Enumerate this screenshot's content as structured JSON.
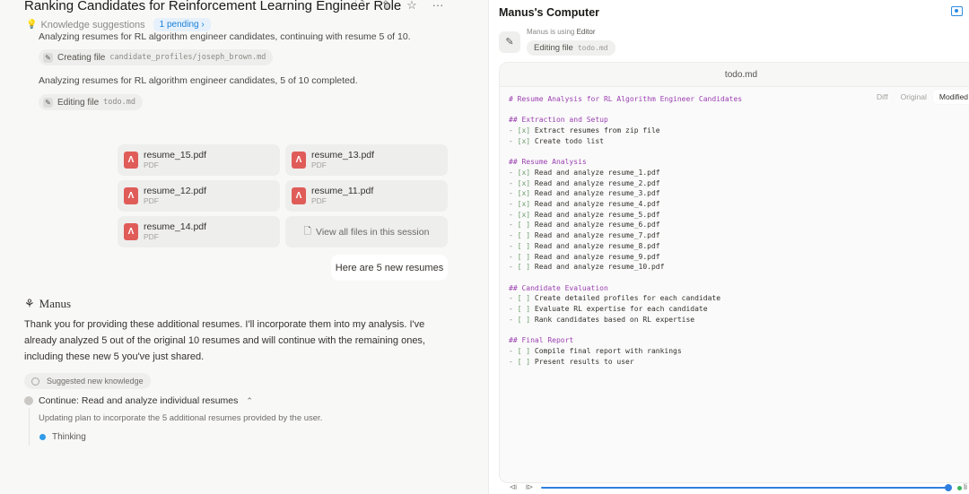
{
  "chat": {
    "title": "Ranking Candidates for Reinforcement Learning Engineer Role",
    "title_actions": [
      "file-icon",
      "share-icon",
      "star-icon",
      "more-icon"
    ],
    "knowledge": {
      "label": "Knowledge suggestions",
      "pending": "1 pending"
    },
    "steps": [
      {
        "text": "Analyzing resumes for RL algorithm engineer candidates, continuing with resume 5 of 10.",
        "action": "Creating file",
        "target": "candidate_profiles/joseph_brown.md"
      },
      {
        "text": "Analyzing resumes for RL algorithm engineer candidates, 5 of 10 completed.",
        "action": "Editing file",
        "target": "todo.md"
      }
    ],
    "files": [
      {
        "name": "resume_15.pdf",
        "type": "PDF"
      },
      {
        "name": "resume_13.pdf",
        "type": "PDF"
      },
      {
        "name": "resume_12.pdf",
        "type": "PDF"
      },
      {
        "name": "resume_11.pdf",
        "type": "PDF"
      },
      {
        "name": "resume_14.pdf",
        "type": "PDF"
      }
    ],
    "view_all": "View all files in this session",
    "user_message": "Here are 5 new resumes",
    "assistant_name": "Manus",
    "assistant_message": "Thank you for providing these additional resumes. I'll incorporate them into my analysis. I've already analyzed 5 out of the original 10 resumes and will continue with the remaining ones, including these new 5 you've just shared.",
    "suggested_knowledge": "Suggested new knowledge",
    "task": {
      "title": "Continue: Read and analyze individual resumes",
      "description": "Updating plan to incorporate the 5 additional resumes provided by the user.",
      "status": "Thinking"
    }
  },
  "computer": {
    "title": "Manus's Computer",
    "using_prefix": "Manus is using",
    "tool": "Editor",
    "action": "Editing file",
    "file": "todo.md",
    "editor_title": "todo.md",
    "view_tabs": [
      "Diff",
      "Original",
      "Modified"
    ],
    "active_view": "Modified",
    "code_lines": [
      {
        "kind": "h",
        "text": "# Resume Analysis for RL Algorithm Engineer Candidates"
      },
      {
        "kind": "blank",
        "text": ""
      },
      {
        "kind": "h",
        "text": "## Extraction and Setup"
      },
      {
        "kind": "item",
        "checked": true,
        "text": "Extract resumes from zip file"
      },
      {
        "kind": "item",
        "checked": true,
        "text": "Create todo list"
      },
      {
        "kind": "blank",
        "text": ""
      },
      {
        "kind": "h",
        "text": "## Resume Analysis"
      },
      {
        "kind": "item",
        "checked": true,
        "text": "Read and analyze resume_1.pdf"
      },
      {
        "kind": "item",
        "checked": true,
        "text": "Read and analyze resume_2.pdf"
      },
      {
        "kind": "item",
        "checked": true,
        "text": "Read and analyze resume_3.pdf"
      },
      {
        "kind": "item",
        "checked": true,
        "text": "Read and analyze resume_4.pdf"
      },
      {
        "kind": "item",
        "checked": true,
        "text": "Read and analyze resume_5.pdf"
      },
      {
        "kind": "item",
        "checked": false,
        "text": "Read and analyze resume_6.pdf"
      },
      {
        "kind": "item",
        "checked": false,
        "text": "Read and analyze resume_7.pdf"
      },
      {
        "kind": "item",
        "checked": false,
        "text": "Read and analyze resume_8.pdf"
      },
      {
        "kind": "item",
        "checked": false,
        "text": "Read and analyze resume_9.pdf"
      },
      {
        "kind": "item",
        "checked": false,
        "text": "Read and analyze resume_10.pdf"
      },
      {
        "kind": "blank",
        "text": ""
      },
      {
        "kind": "h",
        "text": "## Candidate Evaluation"
      },
      {
        "kind": "item",
        "checked": false,
        "text": "Create detailed profiles for each candidate"
      },
      {
        "kind": "item",
        "checked": false,
        "text": "Evaluate RL expertise for each candidate"
      },
      {
        "kind": "item",
        "checked": false,
        "text": "Rank candidates based on RL expertise"
      },
      {
        "kind": "blank",
        "text": ""
      },
      {
        "kind": "h",
        "text": "## Final Report"
      },
      {
        "kind": "item",
        "checked": false,
        "text": "Compile final report with rankings"
      },
      {
        "kind": "item",
        "checked": false,
        "text": "Present results to user"
      }
    ],
    "playback": {
      "progress_percent": 100,
      "live_label": "li"
    },
    "colors": {
      "accent": "#2f7fe0",
      "heading": "#9b3fb0",
      "checkbox": "#6b9d6b",
      "pdf": "#e05c59",
      "live": "#3bb55b"
    }
  }
}
